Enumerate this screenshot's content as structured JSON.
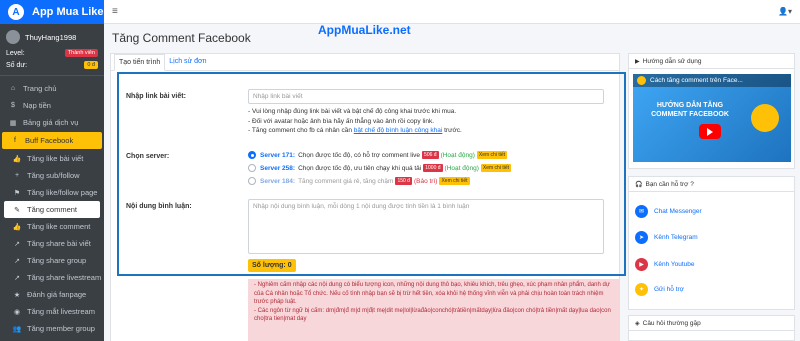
{
  "brand": {
    "name": "App Mua Like",
    "logo_letter": "A"
  },
  "user": {
    "username": "ThuyHang1998",
    "level_label": "Level:",
    "level_value": "Thành viên",
    "balance_label": "Số dư:",
    "balance_value": "0 đ"
  },
  "sidebar": {
    "items": [
      {
        "label": "Trang chủ",
        "icon": "⌂"
      },
      {
        "label": "Nạp tiền",
        "icon": "$"
      },
      {
        "label": "Bảng giá dịch vụ",
        "icon": "▦"
      }
    ],
    "group": {
      "label": "Buff Facebook",
      "icon": "f"
    },
    "sub_items": [
      {
        "label": "Tăng like bài viết",
        "icon": "👍"
      },
      {
        "label": "Tăng sub/follow",
        "icon": "+"
      },
      {
        "label": "Tăng like/follow page",
        "icon": "⚑"
      },
      {
        "label": "Tăng comment",
        "icon": "✎"
      },
      {
        "label": "Tăng like comment",
        "icon": "👍"
      },
      {
        "label": "Tăng share bài viết",
        "icon": "↗"
      },
      {
        "label": "Tăng share group",
        "icon": "↗"
      },
      {
        "label": "Tăng share livestream",
        "icon": "↗"
      },
      {
        "label": "Đánh giá fanpage",
        "icon": "★"
      },
      {
        "label": "Tăng mắt livestream",
        "icon": "◉"
      },
      {
        "label": "Tăng member group",
        "icon": "👥"
      }
    ]
  },
  "header": {
    "menu_icon": "≡",
    "user_icon": "👤▾"
  },
  "page_title": "Tăng Comment Facebook",
  "watermark": "AppMuaLike.net",
  "tabs": {
    "create": "Tạo tiến trình",
    "history": "Lịch sử đơn"
  },
  "form": {
    "link_label": "Nhập link bài viết:",
    "link_placeholder": "Nhập link bài viết",
    "notes": {
      "line1": "- Vui lòng nhập đúng link bài viết và bật chế độ công khai trước khi mua.",
      "line2": "- Đối với avatar hoặc ảnh bìa hãy ấn thẳng vào ảnh rồi copy link.",
      "line3_prefix": "- Tăng comment cho fb cá nhân cần",
      "line3_link": "bật chế độ bình luận công khai",
      "line3_suffix": "trước."
    },
    "server_label": "Chọn server:",
    "servers": [
      {
        "name": "Server 171:",
        "desc": "Chọn được tốc độ, có hỗ trợ comment live",
        "price": "506 đ",
        "status": "(Hoạt động)",
        "detail": "Xem chi tiết"
      },
      {
        "name": "Server 258:",
        "desc": "Chọn được tốc độ, ưu tiên chạy khi quá tải",
        "price": "1000 đ",
        "status": "(Hoạt động)",
        "detail": "Xem chi tiết"
      },
      {
        "name": "Server 184:",
        "desc": "Tăng comment giá rẻ, tăng chậm",
        "price": "150 đ",
        "status": "(Bảo trì)",
        "detail": "Xem chi tiết"
      }
    ],
    "content_label": "Nội dung bình luận:",
    "content_placeholder": "Nhập nội dung bình luận, mỗi dòng 1 nội dung được tính tiền là 1 bình luận",
    "quantity": "Số lượng: 0"
  },
  "warning": {
    "line1": "- Nghiêm cấm nhập các nội dung có biểu tượng icon, những nội dung thô bạo, khiêu khích, trêu ghẹo, xúc phạm nhân phẩm, danh dự của Cá nhân hoặc Tổ chức. Nếu cố tình nhập bạn sẽ bị trừ hết tiền, xóa khỏi hệ thống vĩnh viễn và phải chịu hoàn toàn trách nhiệm trước pháp luật.",
    "line2": "- Các ngôn từ ngữ bị cấm: dm|đm|đ m|d m|địt mẹ|dit me|lol|lừađảo|conchó|trảtiền|mấtdạy|lừa đảo|con chó|trả tiền|mất dạy|lua dao|con cho|tra tien|mat day"
  },
  "right": {
    "guide_title": "Hướng dẫn sử dụng",
    "video_title": "Cách tăng comment trên Face...",
    "video_text": "HƯỚNG DẪN TĂNG COMMENT FACEBOOK",
    "support_title": "Bạn cần hỗ trợ ?",
    "support_items": [
      {
        "label": "Chat Messenger",
        "icon": "✉",
        "color": "#0d6efd"
      },
      {
        "label": "Kênh Telegram",
        "icon": "➤",
        "color": "#0d6efd"
      },
      {
        "label": "Kênh Youtube",
        "icon": "▶",
        "color": "#dc3545"
      },
      {
        "label": "Gửi hỗ trợ",
        "icon": "✦",
        "color": "#ffc107"
      }
    ],
    "faq_title": "Câu hỏi thường gặp"
  }
}
